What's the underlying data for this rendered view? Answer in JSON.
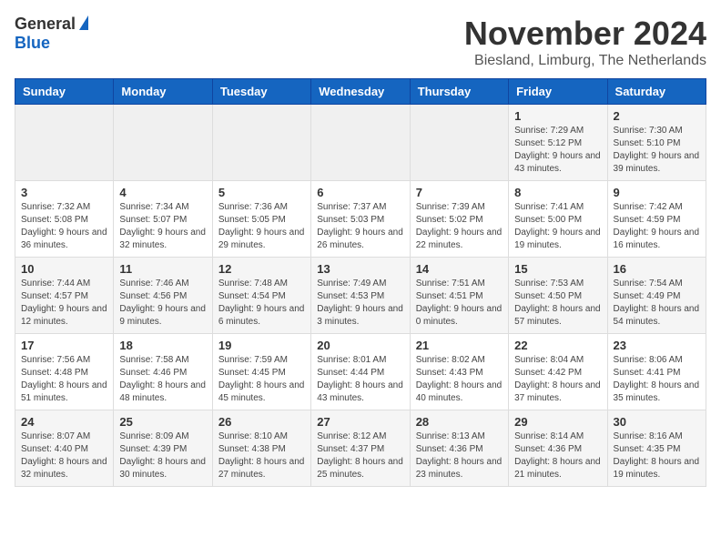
{
  "header": {
    "logo_general": "General",
    "logo_blue": "Blue",
    "month_title": "November 2024",
    "subtitle": "Biesland, Limburg, The Netherlands"
  },
  "days_of_week": [
    "Sunday",
    "Monday",
    "Tuesday",
    "Wednesday",
    "Thursday",
    "Friday",
    "Saturday"
  ],
  "weeks": [
    [
      {
        "day": "",
        "info": ""
      },
      {
        "day": "",
        "info": ""
      },
      {
        "day": "",
        "info": ""
      },
      {
        "day": "",
        "info": ""
      },
      {
        "day": "",
        "info": ""
      },
      {
        "day": "1",
        "info": "Sunrise: 7:29 AM\nSunset: 5:12 PM\nDaylight: 9 hours and 43 minutes."
      },
      {
        "day": "2",
        "info": "Sunrise: 7:30 AM\nSunset: 5:10 PM\nDaylight: 9 hours and 39 minutes."
      }
    ],
    [
      {
        "day": "3",
        "info": "Sunrise: 7:32 AM\nSunset: 5:08 PM\nDaylight: 9 hours and 36 minutes."
      },
      {
        "day": "4",
        "info": "Sunrise: 7:34 AM\nSunset: 5:07 PM\nDaylight: 9 hours and 32 minutes."
      },
      {
        "day": "5",
        "info": "Sunrise: 7:36 AM\nSunset: 5:05 PM\nDaylight: 9 hours and 29 minutes."
      },
      {
        "day": "6",
        "info": "Sunrise: 7:37 AM\nSunset: 5:03 PM\nDaylight: 9 hours and 26 minutes."
      },
      {
        "day": "7",
        "info": "Sunrise: 7:39 AM\nSunset: 5:02 PM\nDaylight: 9 hours and 22 minutes."
      },
      {
        "day": "8",
        "info": "Sunrise: 7:41 AM\nSunset: 5:00 PM\nDaylight: 9 hours and 19 minutes."
      },
      {
        "day": "9",
        "info": "Sunrise: 7:42 AM\nSunset: 4:59 PM\nDaylight: 9 hours and 16 minutes."
      }
    ],
    [
      {
        "day": "10",
        "info": "Sunrise: 7:44 AM\nSunset: 4:57 PM\nDaylight: 9 hours and 12 minutes."
      },
      {
        "day": "11",
        "info": "Sunrise: 7:46 AM\nSunset: 4:56 PM\nDaylight: 9 hours and 9 minutes."
      },
      {
        "day": "12",
        "info": "Sunrise: 7:48 AM\nSunset: 4:54 PM\nDaylight: 9 hours and 6 minutes."
      },
      {
        "day": "13",
        "info": "Sunrise: 7:49 AM\nSunset: 4:53 PM\nDaylight: 9 hours and 3 minutes."
      },
      {
        "day": "14",
        "info": "Sunrise: 7:51 AM\nSunset: 4:51 PM\nDaylight: 9 hours and 0 minutes."
      },
      {
        "day": "15",
        "info": "Sunrise: 7:53 AM\nSunset: 4:50 PM\nDaylight: 8 hours and 57 minutes."
      },
      {
        "day": "16",
        "info": "Sunrise: 7:54 AM\nSunset: 4:49 PM\nDaylight: 8 hours and 54 minutes."
      }
    ],
    [
      {
        "day": "17",
        "info": "Sunrise: 7:56 AM\nSunset: 4:48 PM\nDaylight: 8 hours and 51 minutes."
      },
      {
        "day": "18",
        "info": "Sunrise: 7:58 AM\nSunset: 4:46 PM\nDaylight: 8 hours and 48 minutes."
      },
      {
        "day": "19",
        "info": "Sunrise: 7:59 AM\nSunset: 4:45 PM\nDaylight: 8 hours and 45 minutes."
      },
      {
        "day": "20",
        "info": "Sunrise: 8:01 AM\nSunset: 4:44 PM\nDaylight: 8 hours and 43 minutes."
      },
      {
        "day": "21",
        "info": "Sunrise: 8:02 AM\nSunset: 4:43 PM\nDaylight: 8 hours and 40 minutes."
      },
      {
        "day": "22",
        "info": "Sunrise: 8:04 AM\nSunset: 4:42 PM\nDaylight: 8 hours and 37 minutes."
      },
      {
        "day": "23",
        "info": "Sunrise: 8:06 AM\nSunset: 4:41 PM\nDaylight: 8 hours and 35 minutes."
      }
    ],
    [
      {
        "day": "24",
        "info": "Sunrise: 8:07 AM\nSunset: 4:40 PM\nDaylight: 8 hours and 32 minutes."
      },
      {
        "day": "25",
        "info": "Sunrise: 8:09 AM\nSunset: 4:39 PM\nDaylight: 8 hours and 30 minutes."
      },
      {
        "day": "26",
        "info": "Sunrise: 8:10 AM\nSunset: 4:38 PM\nDaylight: 8 hours and 27 minutes."
      },
      {
        "day": "27",
        "info": "Sunrise: 8:12 AM\nSunset: 4:37 PM\nDaylight: 8 hours and 25 minutes."
      },
      {
        "day": "28",
        "info": "Sunrise: 8:13 AM\nSunset: 4:36 PM\nDaylight: 8 hours and 23 minutes."
      },
      {
        "day": "29",
        "info": "Sunrise: 8:14 AM\nSunset: 4:36 PM\nDaylight: 8 hours and 21 minutes."
      },
      {
        "day": "30",
        "info": "Sunrise: 8:16 AM\nSunset: 4:35 PM\nDaylight: 8 hours and 19 minutes."
      }
    ]
  ]
}
